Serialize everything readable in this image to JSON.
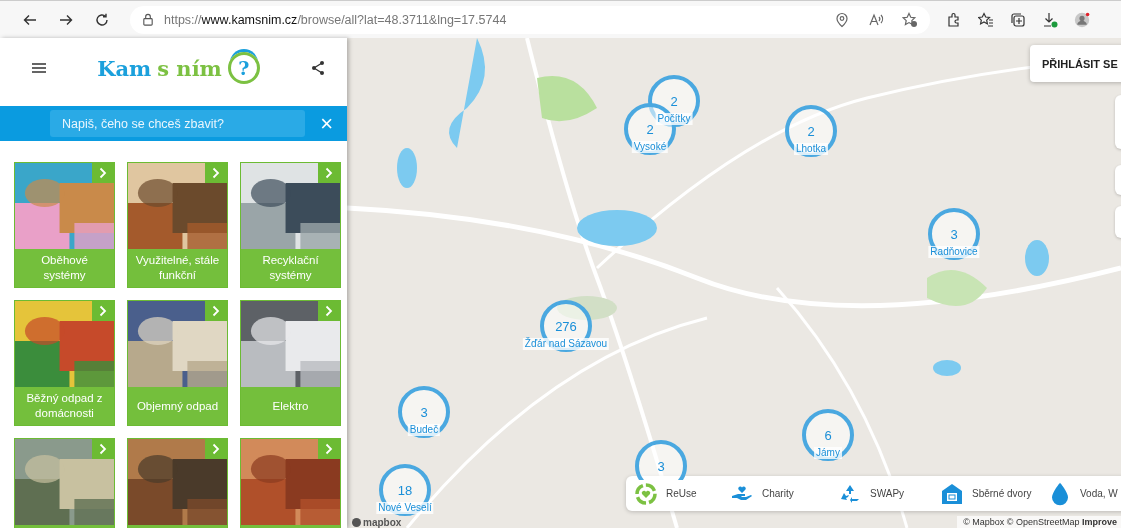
{
  "browser": {
    "url": "https://**www.kamsnim.cz**/browse/all?lat=48.3711&lng=17.5744"
  },
  "header": {
    "logo_word_1": "Kam",
    "logo_word_2": "s ním",
    "logo_mark": "?"
  },
  "search": {
    "placeholder": "Napiš, čeho se chceš zbavit?",
    "clear": "×"
  },
  "tiles": [
    {
      "kind": "picture",
      "label": "Oběhové systémy"
    },
    {
      "kind": "picture",
      "label": "Využitelné, stále funkční"
    },
    {
      "kind": "picture",
      "label": "Recyklační systémy"
    },
    {
      "kind": "picture",
      "label": "Běžný odpad z domácnosti"
    },
    {
      "kind": "picture",
      "label": "Objemný odpad"
    },
    {
      "kind": "picture",
      "label": "Elektro"
    },
    {
      "kind": "picture"
    },
    {
      "kind": "picture"
    },
    {
      "kind": "picture"
    }
  ],
  "map": {
    "login": "PŘIHLÁSIT SE",
    "clusters": [
      {
        "count": "2",
        "label": "Počítky"
      },
      {
        "count": "2",
        "label": "Vysoké"
      },
      {
        "count": "2",
        "label": "Lhotka"
      },
      {
        "count": "3",
        "label": "Radňovice"
      },
      {
        "count": "276",
        "label": "Žďár nad Sázavou"
      },
      {
        "count": "3",
        "label": "Budeč"
      },
      {
        "count": "6",
        "label": "Jámy"
      },
      {
        "count": "3"
      },
      {
        "count": "18",
        "label": "Nové Veselí"
      }
    ],
    "legend": [
      {
        "kind": "reuse",
        "label": "ReUse"
      },
      {
        "kind": "charity",
        "label": "Charity"
      },
      {
        "kind": "swap",
        "label": "SWAPy"
      },
      {
        "kind": "yard",
        "label": "Sběrné dvory"
      },
      {
        "kind": "water",
        "label": "Voda, W"
      }
    ],
    "logo": "mapbox",
    "attribution": "© Mapbox © OpenStreetMap",
    "improve": "Improve"
  }
}
